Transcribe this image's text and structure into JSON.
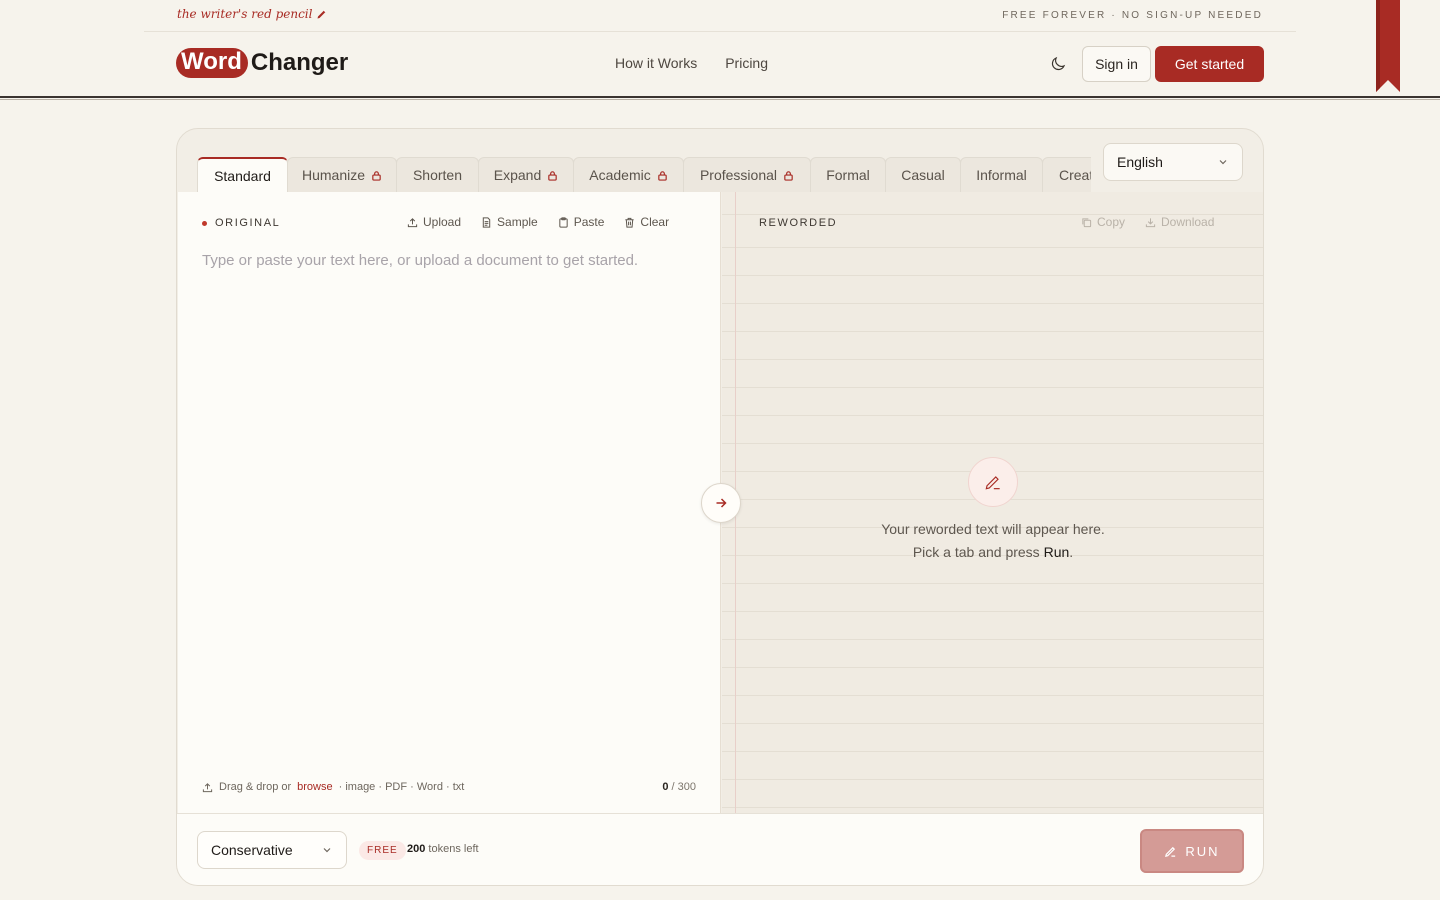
{
  "topbar": {
    "tagline": "the writer's red pencil",
    "right_text": "FREE FOREVER · NO SIGN-UP NEEDED"
  },
  "header": {
    "logo_word": "Word",
    "logo_changer": "Changer",
    "nav": [
      "How it Works",
      "Pricing"
    ],
    "signin_label": "Sign in",
    "start_label": "Get started"
  },
  "tabs": [
    {
      "label": "Standard",
      "locked": false,
      "active": true
    },
    {
      "label": "Humanize",
      "locked": true,
      "active": false
    },
    {
      "label": "Shorten",
      "locked": false,
      "active": false
    },
    {
      "label": "Expand",
      "locked": true,
      "active": false
    },
    {
      "label": "Academic",
      "locked": true,
      "active": false
    },
    {
      "label": "Professional",
      "locked": true,
      "active": false
    },
    {
      "label": "Formal",
      "locked": false,
      "active": false
    },
    {
      "label": "Casual",
      "locked": false,
      "active": false
    },
    {
      "label": "Informal",
      "locked": false,
      "active": false
    },
    {
      "label": "Creative",
      "locked": false,
      "active": false
    }
  ],
  "language": {
    "selected": "English"
  },
  "original": {
    "title": "ORIGINAL",
    "tools": [
      "Upload",
      "Sample",
      "Paste",
      "Clear"
    ],
    "placeholder": "Type or paste your text here, or upload a document to get started.",
    "drop_prefix": "Drag & drop or",
    "drop_link": "browse",
    "drop_suffix": "· image · PDF · Word · txt",
    "count_current": "0",
    "count_max": "/ 300"
  },
  "reworded": {
    "title": "REWORDED",
    "tools": [
      "Copy",
      "Download"
    ],
    "empty_line1": "Your reworded text will appear here.",
    "empty_line2": "Pick a tab and press",
    "empty_run": "Run",
    "empty_period": "."
  },
  "bottom": {
    "mode": "Conservative",
    "badge": "FREE",
    "tokens_count": "200",
    "tokens_label": "tokens left",
    "run_label": "RUN"
  },
  "colors": {
    "accent": "#a82b24",
    "background": "#f6f3ec",
    "paper": "#fdfcf8"
  }
}
